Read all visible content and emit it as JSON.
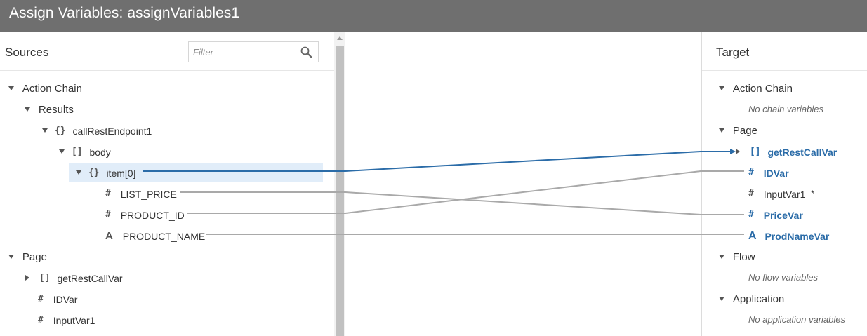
{
  "window": {
    "title": "Assign Variables: assignVariables1"
  },
  "sources": {
    "title": "Sources",
    "filter_placeholder": "Filter",
    "tree": {
      "action_chain": "Action Chain",
      "results": "Results",
      "call_rest": "callRestEndpoint1",
      "body": "body",
      "item": "item[0]",
      "list_price": "LIST_PRICE",
      "product_id": "PRODUCT_ID",
      "product_name": "PRODUCT_NAME",
      "page": "Page",
      "get_rest_call_var": "getRestCallVar",
      "id_var": "IDVar",
      "input_var1": "InputVar1"
    }
  },
  "target": {
    "title": "Target",
    "tree": {
      "action_chain": "Action Chain",
      "no_chain_vars": "No chain variables",
      "page": "Page",
      "get_rest_call_var": "getRestCallVar",
      "id_var": "IDVar",
      "input_var1": "InputVar1",
      "required_mark": "*",
      "price_var": "PriceVar",
      "prod_name_var": "ProdNameVar",
      "flow": "Flow",
      "no_flow_vars": "No flow variables",
      "application": "Application",
      "no_app_vars": "No application variables"
    }
  },
  "icons": {
    "object": "{}",
    "array": "[]",
    "number": "#",
    "string": "A"
  },
  "colors": {
    "mapped_link": "#2b6ca8",
    "link": "#a9a9a9",
    "selected_row": "#e1edf9",
    "titlebar": "#6f6f6f"
  }
}
